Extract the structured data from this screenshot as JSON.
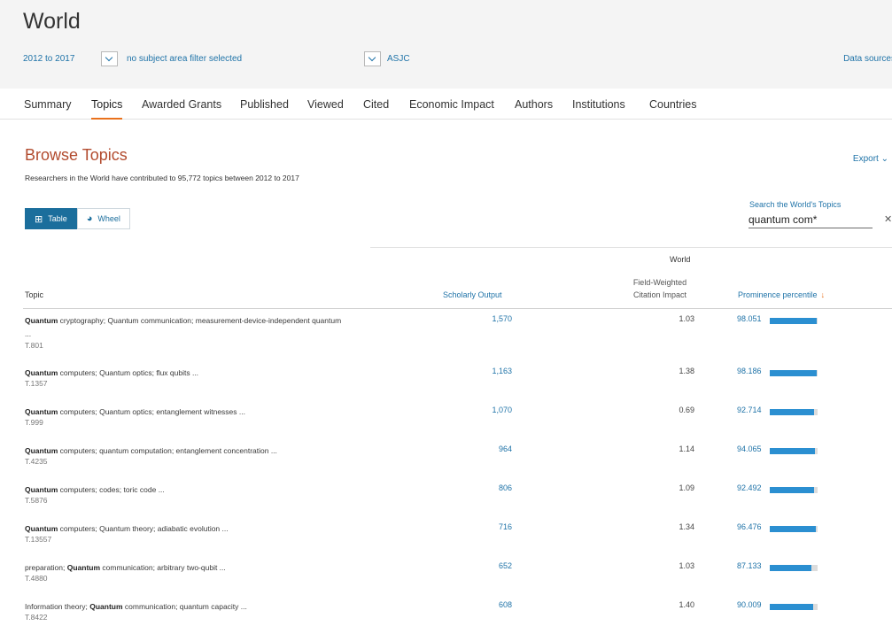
{
  "header": {
    "title": "World",
    "year_range": "2012 to 2017",
    "subject_filter": "no subject area filter selected",
    "classification": "ASJC",
    "data_sources": "Data sources"
  },
  "tabs": [
    "Summary",
    "Topics",
    "Awarded Grants",
    "Published",
    "Viewed",
    "Cited",
    "Economic Impact",
    "Authors",
    "Institutions",
    "Countries"
  ],
  "active_tab": "Topics",
  "browse": {
    "title": "Browse Topics",
    "subtitle": "Researchers in the World have contributed to 95,772 topics between 2012 to 2017",
    "export_label": "Export"
  },
  "view_toggle": {
    "table_label": "Table",
    "wheel_label": "Wheel",
    "selected": "Table"
  },
  "search": {
    "label": "Search the World's Topics",
    "value": "quantum com*",
    "clear_icon": "close-icon"
  },
  "table": {
    "group_header": "World",
    "columns": {
      "topic": "Topic",
      "scholarly_output": "Scholarly Output",
      "fwci": "Field-Weighted Citation Impact",
      "prominence": "Prominence percentile"
    },
    "sort": {
      "column": "prominence",
      "direction": "desc",
      "icon": "arrow-down-icon"
    },
    "rows": [
      {
        "keyword": "Quantum",
        "topic_rest": " cryptography; Quantum communication; measurement-device-independent quantum ...",
        "topic_id": "T.801",
        "scholarly_output": "1,570",
        "fwci": "1.03",
        "prominence": "98.051",
        "bar": 0.98
      },
      {
        "keyword": "Quantum",
        "topic_rest": " computers; Quantum optics; flux qubits ...",
        "topic_id": "T.1357",
        "scholarly_output": "1,163",
        "fwci": "1.38",
        "prominence": "98.186",
        "bar": 0.98
      },
      {
        "keyword": "Quantum",
        "topic_rest": " computers; Quantum optics; entanglement witnesses ...",
        "topic_id": "T.999",
        "scholarly_output": "1,070",
        "fwci": "0.69",
        "prominence": "92.714",
        "bar": 0.93
      },
      {
        "keyword": "Quantum",
        "topic_rest": " computers; quantum computation; entanglement concentration ...",
        "topic_id": "T.4235",
        "scholarly_output": "964",
        "fwci": "1.14",
        "prominence": "94.065",
        "bar": 0.94
      },
      {
        "keyword": "Quantum",
        "topic_rest": " computers; codes; toric code ...",
        "topic_id": "T.5876",
        "scholarly_output": "806",
        "fwci": "1.09",
        "prominence": "92.492",
        "bar": 0.92
      },
      {
        "keyword": "Quantum",
        "topic_rest": " computers; Quantum theory; adiabatic evolution ...",
        "topic_id": "T.13557",
        "scholarly_output": "716",
        "fwci": "1.34",
        "prominence": "96.476",
        "bar": 0.96
      },
      {
        "pre": "preparation; ",
        "keyword": "Quantum",
        "topic_rest": " communication; arbitrary two-qubit ...",
        "topic_id": "T.4880",
        "scholarly_output": "652",
        "fwci": "1.03",
        "prominence": "87.133",
        "bar": 0.87
      },
      {
        "pre": "Information theory; ",
        "keyword": "Quantum",
        "topic_rest": " communication; quantum capacity ...",
        "topic_id": "T.8422",
        "scholarly_output": "608",
        "fwci": "1.40",
        "prominence": "90.009",
        "bar": 0.9
      }
    ]
  },
  "colors": {
    "accent": "#e9711c",
    "link": "#1f73a8",
    "title": "#b24b2e",
    "bar": "#2b8fd1",
    "toggle": "#1b6e9c"
  }
}
